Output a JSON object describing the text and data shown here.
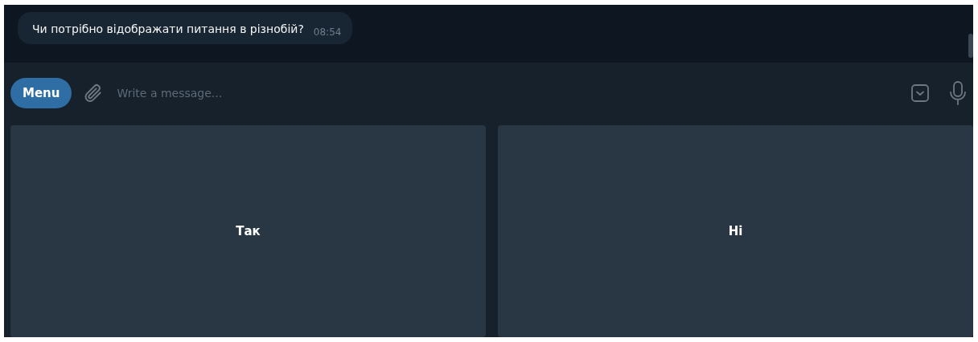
{
  "message": {
    "text": "Чи потрібно відображати питання в різнобій?",
    "time": "08:54"
  },
  "composer": {
    "menu_button": "Menu",
    "placeholder": "Write a message..."
  },
  "keyboard": [
    {
      "label": "Так"
    },
    {
      "label": "Ні"
    }
  ]
}
